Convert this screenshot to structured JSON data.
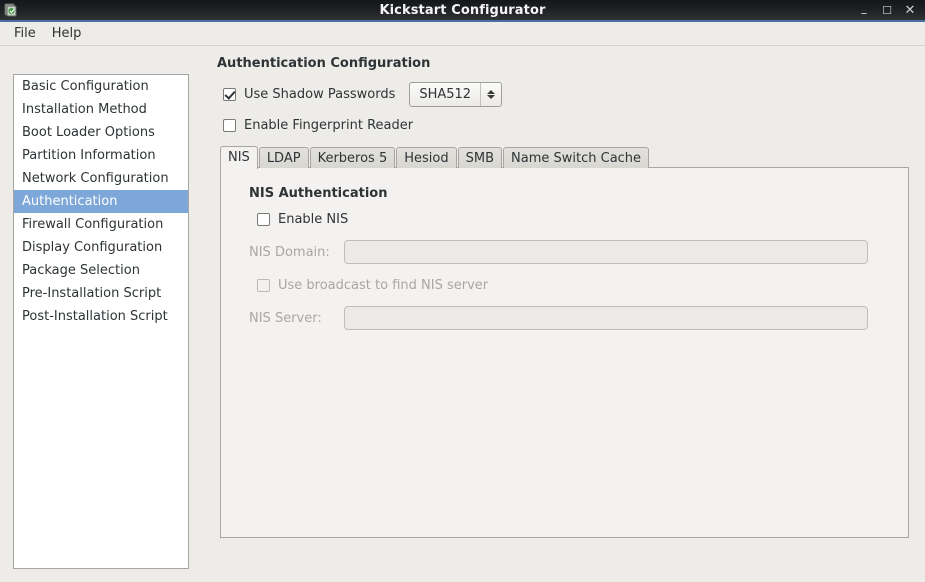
{
  "window": {
    "title": "Kickstart Configurator",
    "icon": "app-icon",
    "controls": {
      "minimize": "–",
      "maximize": "☐",
      "close": "✕"
    }
  },
  "menubar": {
    "items": [
      {
        "label": "File"
      },
      {
        "label": "Help"
      }
    ]
  },
  "sidebar": {
    "items": [
      {
        "label": "Basic Configuration",
        "selected": false
      },
      {
        "label": "Installation Method",
        "selected": false
      },
      {
        "label": "Boot Loader Options",
        "selected": false
      },
      {
        "label": "Partition Information",
        "selected": false
      },
      {
        "label": "Network Configuration",
        "selected": false
      },
      {
        "label": "Authentication",
        "selected": true
      },
      {
        "label": "Firewall Configuration",
        "selected": false
      },
      {
        "label": "Display Configuration",
        "selected": false
      },
      {
        "label": "Package Selection",
        "selected": false
      },
      {
        "label": "Pre-Installation Script",
        "selected": false
      },
      {
        "label": "Post-Installation Script",
        "selected": false
      }
    ]
  },
  "main": {
    "title": "Authentication Configuration",
    "shadow_passwords": {
      "label": "Use Shadow Passwords",
      "checked": true,
      "algorithm": "SHA512"
    },
    "fingerprint": {
      "label": "Enable Fingerprint Reader",
      "checked": false
    },
    "tabs": [
      {
        "label": "NIS",
        "active": true
      },
      {
        "label": "LDAP",
        "active": false
      },
      {
        "label": "Kerberos 5",
        "active": false
      },
      {
        "label": "Hesiod",
        "active": false
      },
      {
        "label": "SMB",
        "active": false
      },
      {
        "label": "Name Switch Cache",
        "active": false
      }
    ],
    "nis": {
      "section_title": "NIS Authentication",
      "enable": {
        "label": "Enable NIS",
        "checked": false
      },
      "domain": {
        "label": "NIS Domain:",
        "value": "",
        "disabled": true
      },
      "broadcast": {
        "label": "Use broadcast to find NIS server",
        "checked": false,
        "disabled": true
      },
      "server": {
        "label": "NIS Server:",
        "value": "",
        "disabled": true
      }
    }
  },
  "colors": {
    "selection": "#7da7d9",
    "titlebar_accent": "#4a6fa5",
    "background": "#edece9",
    "panel": "#f3f2f0"
  }
}
